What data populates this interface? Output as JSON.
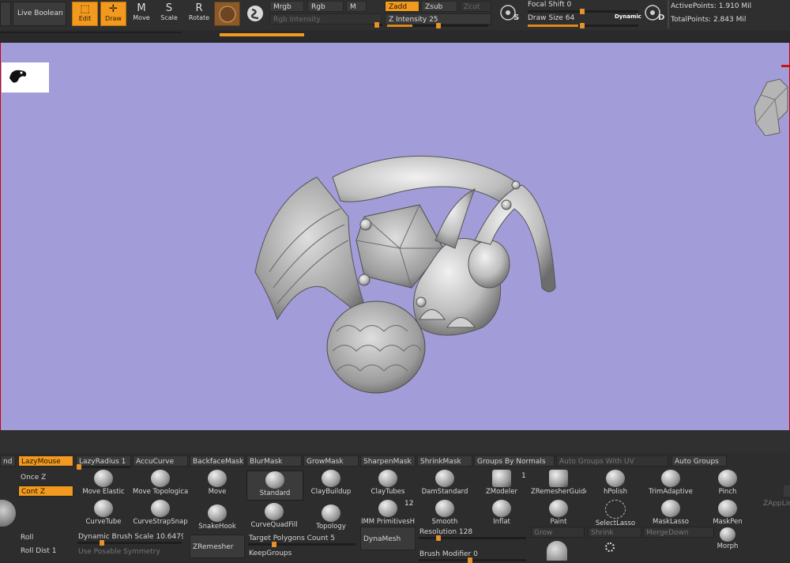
{
  "top": {
    "live_boolean": "Live Boolean",
    "edit": "Edit",
    "draw": "Draw",
    "move": "Move",
    "scale": "Scale",
    "rotate": "Rotate",
    "mrgb": "Mrgb",
    "rgb": "Rgb",
    "m": "M",
    "rgb_intensity": "Rgb Intensity",
    "zadd": "Zadd",
    "zsub": "Zsub",
    "zcut": "Zcut",
    "z_intensity_label": "Z Intensity",
    "z_intensity_value": "25",
    "s_key": "S",
    "focal_shift_label": "Focal Shift",
    "focal_shift_value": "0",
    "draw_size_label": "Draw Size",
    "draw_size_value": "64",
    "dynamic": "Dynamic",
    "d_key": "D",
    "active_points": "ActivePoints: 1.910 Mil",
    "total_points": "TotalPoints: 2.843 Mil"
  },
  "bottom": {
    "row1": [
      "nd",
      "LazyMouse",
      "LazyRadius 1",
      "AccuCurve",
      "BackfaceMask",
      "BlurMask",
      "GrowMask",
      "SharpenMask",
      "ShrinkMask",
      "Groups By Normals",
      "Auto Groups With UV",
      "Auto Groups"
    ],
    "left": {
      "once_z": "Once Z",
      "cont_z": "Cont Z",
      "roll": "Roll",
      "roll_dist": "Roll Dist 1"
    },
    "brushes_row1": [
      "Move Elastic",
      "Move Topologica",
      "Move",
      "Standard",
      "ClayBuildup",
      "ClayTubes",
      "DamStandard",
      "ZModeler",
      "ZRemesherGuide",
      "hPolish",
      "TrimAdaptive",
      "Pinch"
    ],
    "zmodeler_badge": "1",
    "brushes_row2": [
      "CurveTube",
      "CurveStrapSnap",
      "SnakeHook",
      "CurveQuadFill",
      "Topology",
      "IMM PrimitivesH",
      "Smooth",
      "Inflat",
      "Paint",
      "SelectLasso",
      "MaskLasso",
      "MaskPen"
    ],
    "imm_badge": "12",
    "zapplink": "ZAppLin",
    "dynamic_brush_scale": "Dynamic Brush Scale 10.64793",
    "use_posable_symmetry": "Use Posable Symmetry",
    "zremesher": "ZRemesher",
    "target_polygons": "Target Polygons Count 5",
    "keepgroups": "KeepGroups",
    "dynamesh": "DynaMesh",
    "resolution": "Resolution 128",
    "brush_modifier": "Brush Modifier 0",
    "grow": "Grow",
    "shrink": "Shrink",
    "mergedown": "MergeDown",
    "morph": "Morph"
  }
}
